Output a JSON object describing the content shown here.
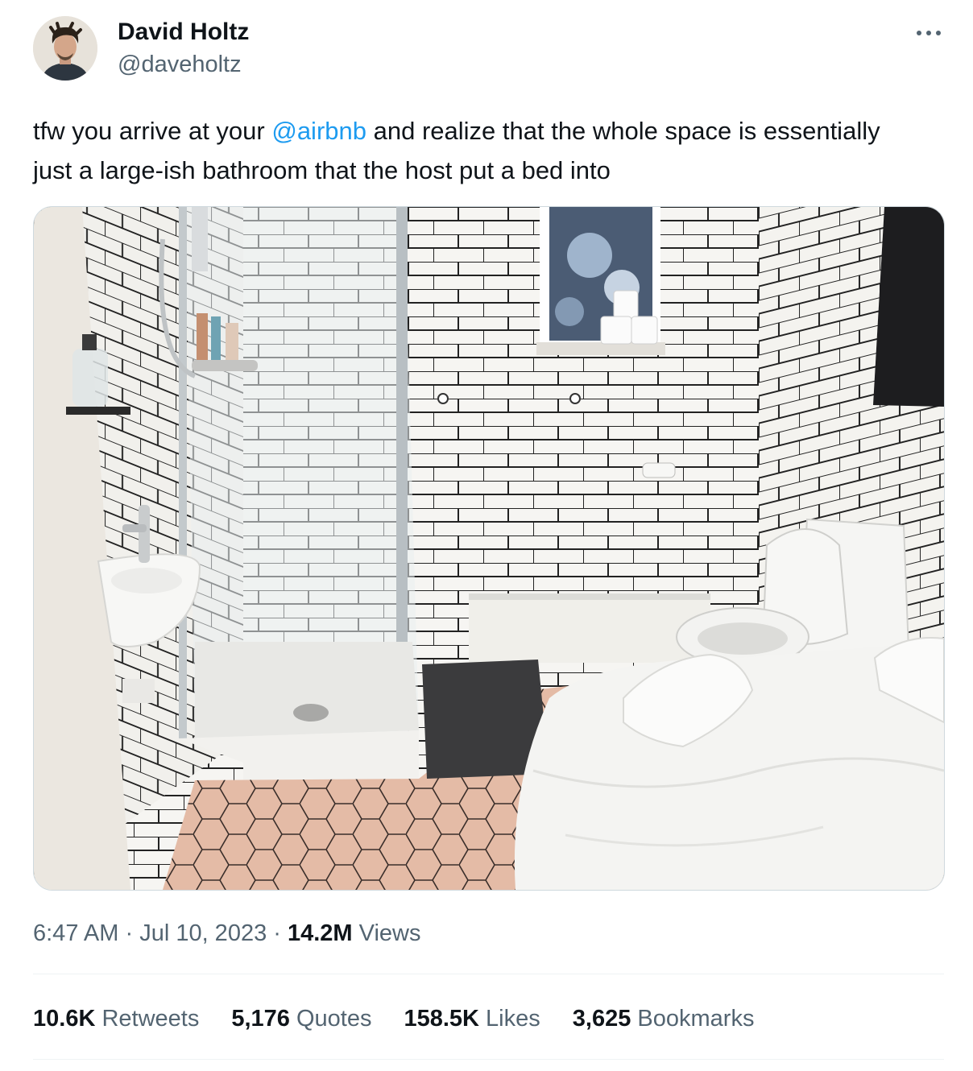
{
  "author": {
    "name": "David Holtz",
    "handle": "@daveholtz"
  },
  "tweet": {
    "text_before": "tfw you arrive at your ",
    "mention": "@airbnb",
    "text_after": " and realize that the whole space is essentially just a large-ish bathroom that the host put a bed into"
  },
  "meta": {
    "time": "6:47 AM",
    "separator": " · ",
    "date": "Jul 10, 2023",
    "views_count": "14.2M",
    "views_label": " Views"
  },
  "stats": [
    {
      "count": "10.6K",
      "label": " Retweets"
    },
    {
      "count": "5,176",
      "label": " Quotes"
    },
    {
      "count": "158.5K",
      "label": " Likes"
    },
    {
      "count": "3,625",
      "label": " Bookmarks"
    }
  ],
  "icons": {
    "more": "more-horizontal-icon"
  },
  "colors": {
    "text": "#0f1419",
    "secondary": "#536471",
    "link": "#1d9bf0",
    "border": "#cfd9de",
    "divider": "#eff3f4"
  }
}
